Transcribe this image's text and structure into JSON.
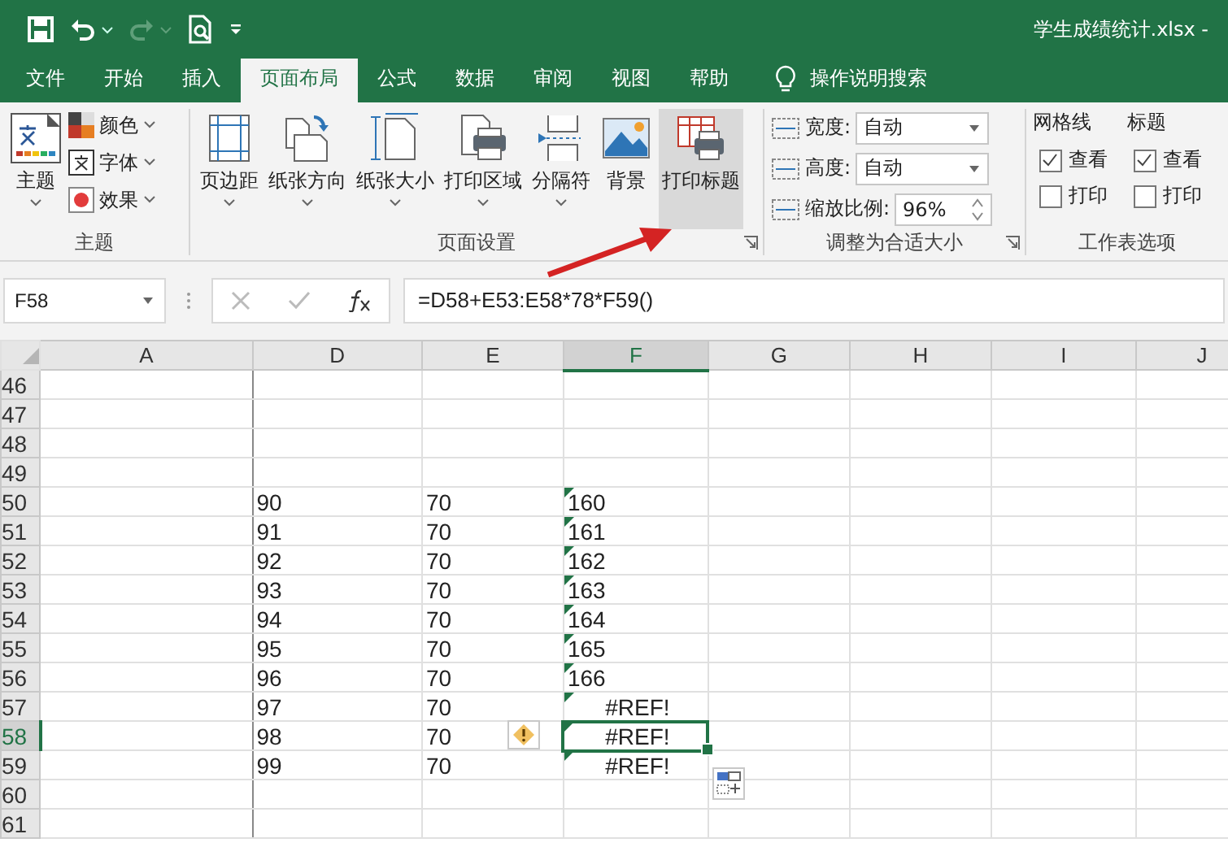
{
  "window": {
    "title": "学生成绩统计.xlsx  -"
  },
  "tabs": [
    {
      "label": "文件",
      "selected": false
    },
    {
      "label": "开始",
      "selected": false
    },
    {
      "label": "插入",
      "selected": false
    },
    {
      "label": "页面布局",
      "selected": true
    },
    {
      "label": "公式",
      "selected": false
    },
    {
      "label": "数据",
      "selected": false
    },
    {
      "label": "审阅",
      "selected": false
    },
    {
      "label": "视图",
      "selected": false
    },
    {
      "label": "帮助",
      "selected": false
    }
  ],
  "search_hint": "操作说明搜索",
  "ribbon": {
    "theme_group": {
      "label": "主题",
      "big_button": "主题",
      "items": [
        "颜色",
        "字体",
        "效果"
      ]
    },
    "page_setup_group": {
      "label": "页面设置",
      "buttons": [
        {
          "label": "页边距",
          "dropdown": true,
          "highlighted": false
        },
        {
          "label": "纸张方向",
          "dropdown": true,
          "highlighted": false
        },
        {
          "label": "纸张大小",
          "dropdown": true,
          "highlighted": false
        },
        {
          "label": "打印区域",
          "dropdown": true,
          "highlighted": false
        },
        {
          "label": "分隔符",
          "dropdown": true,
          "highlighted": false
        },
        {
          "label": "背景",
          "dropdown": false,
          "highlighted": false
        },
        {
          "label": "打印标题",
          "dropdown": false,
          "highlighted": true
        }
      ]
    },
    "scale_group": {
      "label": "调整为合适大小",
      "fields": [
        {
          "label": "宽度:",
          "value": "自动",
          "kind": "dropdown"
        },
        {
          "label": "高度:",
          "value": "自动",
          "kind": "dropdown"
        },
        {
          "label": "缩放比例:",
          "value": "96%",
          "kind": "spinner"
        }
      ]
    },
    "sheet_options_group": {
      "label": "工作表选项",
      "columns": [
        {
          "heading": "网格线",
          "options": [
            {
              "label": "查看",
              "checked": true
            },
            {
              "label": "打印",
              "checked": false
            }
          ]
        },
        {
          "heading": "标题",
          "options": [
            {
              "label": "查看",
              "checked": true
            },
            {
              "label": "打印",
              "checked": false
            }
          ]
        }
      ]
    }
  },
  "formula_bar": {
    "name_box": "F58",
    "formula": "=D58+E53:E58*78*F59()"
  },
  "sheet": {
    "columns": [
      {
        "label": "A",
        "selected": false
      },
      {
        "label": "D",
        "selected": false
      },
      {
        "label": "E",
        "selected": false
      },
      {
        "label": "F",
        "selected": true
      },
      {
        "label": "G",
        "selected": false
      },
      {
        "label": "H",
        "selected": false
      },
      {
        "label": "I",
        "selected": false
      },
      {
        "label": "J",
        "selected": false
      }
    ],
    "rows": [
      {
        "number": "46",
        "selected": false
      },
      {
        "number": "47",
        "selected": false
      },
      {
        "number": "48",
        "selected": false
      },
      {
        "number": "49",
        "selected": false
      },
      {
        "number": "50",
        "selected": false,
        "d": "90",
        "e": "70",
        "f": "160",
        "f_error": false,
        "f_flag": true
      },
      {
        "number": "51",
        "selected": false,
        "d": "91",
        "e": "70",
        "f": "161",
        "f_error": false,
        "f_flag": true
      },
      {
        "number": "52",
        "selected": false,
        "d": "92",
        "e": "70",
        "f": "162",
        "f_error": false,
        "f_flag": true
      },
      {
        "number": "53",
        "selected": false,
        "d": "93",
        "e": "70",
        "f": "163",
        "f_error": false,
        "f_flag": true
      },
      {
        "number": "54",
        "selected": false,
        "d": "94",
        "e": "70",
        "f": "164",
        "f_error": false,
        "f_flag": true
      },
      {
        "number": "55",
        "selected": false,
        "d": "95",
        "e": "70",
        "f": "165",
        "f_error": false,
        "f_flag": true
      },
      {
        "number": "56",
        "selected": false,
        "d": "96",
        "e": "70",
        "f": "166",
        "f_error": false,
        "f_flag": true
      },
      {
        "number": "57",
        "selected": false,
        "d": "97",
        "e": "70",
        "f": "#REF!",
        "f_error": true,
        "f_flag": true
      },
      {
        "number": "58",
        "selected": true,
        "d": "98",
        "e": "70",
        "f": "#REF!",
        "f_error": true,
        "f_flag": true,
        "active": true,
        "warning": true
      },
      {
        "number": "59",
        "selected": false,
        "d": "99",
        "e": "70",
        "f": "#REF!",
        "f_error": true,
        "f_flag": true,
        "paste_options": true
      },
      {
        "number": "60",
        "selected": false
      },
      {
        "number": "61",
        "selected": false
      }
    ]
  }
}
